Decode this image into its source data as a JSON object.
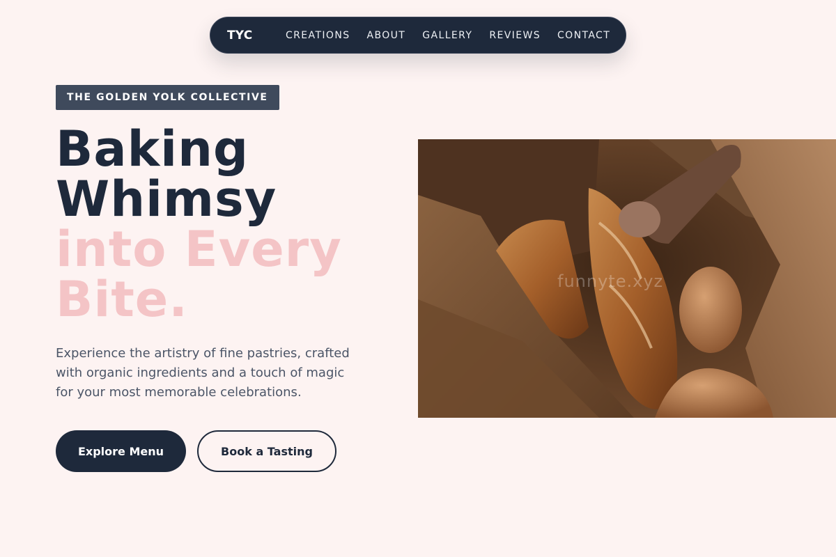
{
  "nav": {
    "brand": "TYC",
    "links": [
      "CREATIONS",
      "ABOUT",
      "GALLERY",
      "REVIEWS",
      "CONTACT"
    ]
  },
  "hero": {
    "eyebrow": "THE GOLDEN YOLK COLLECTIVE",
    "headline_dark_1": "Baking",
    "headline_dark_2": "Whimsy",
    "headline_pink_1": "into Every",
    "headline_pink_2": "Bite.",
    "subtitle": "Experience the artistry of fine pastries, crafted with organic ingredients and a touch of magic for your most memorable celebrations.",
    "primary_button": "Explore Menu",
    "secondary_button": "Book a Tasting",
    "image_watermark": "funnyte.xyz"
  },
  "colors": {
    "background": "#fdf3f2",
    "navy": "#1e293b",
    "pink_accent": "#f4c4c6",
    "eyebrow_bg": "#3f4a5c"
  }
}
